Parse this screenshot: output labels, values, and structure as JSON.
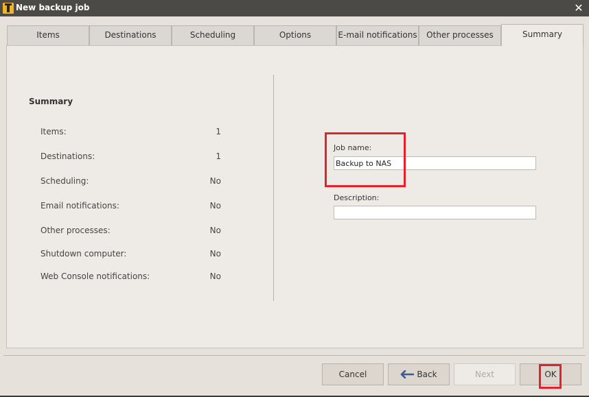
{
  "window": {
    "title": "New backup job",
    "close_glyph": "✕"
  },
  "tabs": [
    {
      "label": "Items",
      "active": false
    },
    {
      "label": "Destinations",
      "active": false
    },
    {
      "label": "Scheduling",
      "active": false
    },
    {
      "label": "Options",
      "active": false
    },
    {
      "label": "E-mail notifications",
      "active": false
    },
    {
      "label": "Other processes",
      "active": false
    },
    {
      "label": "Summary",
      "active": true
    }
  ],
  "summary": {
    "title": "Summary",
    "rows": [
      {
        "label": "Items:",
        "value": "1"
      },
      {
        "label": "Destinations:",
        "value": "1"
      },
      {
        "label": "Scheduling:",
        "value": "No"
      },
      {
        "label": "Email notifications:",
        "value": "No"
      },
      {
        "label": "Other processes:",
        "value": "No"
      },
      {
        "label": "Shutdown computer:",
        "value": "No"
      },
      {
        "label": "Web Console notifications:",
        "value": "No"
      }
    ]
  },
  "form": {
    "job_name_label": "Job name:",
    "job_name_value": "Backup to NAS",
    "description_label": "Description:",
    "description_value": ""
  },
  "buttons": {
    "cancel": "Cancel",
    "back": "Back",
    "next": "Next",
    "ok": "OK"
  },
  "colors": {
    "highlight": "#e8202a",
    "titlebar": "#4c4a46",
    "back_arrow": "#3b5a8f"
  }
}
